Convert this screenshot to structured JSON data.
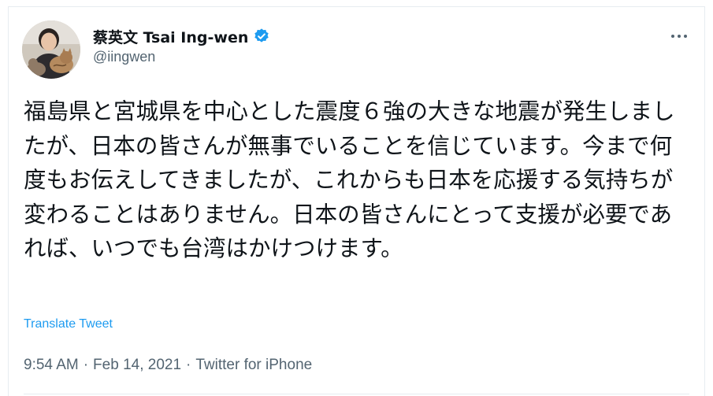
{
  "tweet": {
    "author": {
      "display_name": "蔡英文 Tsai Ing-wen",
      "handle": "@iingwen",
      "verified": true,
      "avatar_icon": "profile-photo-with-cat"
    },
    "more_icon": "ellipsis-horizontal-icon",
    "text": "福島県と宮城県を中心とした震度６強の大きな地震が発生しましたが、日本の皆さんが無事でいることを信じています。今まで何度もお伝えしてきましたが、これからも日本を応援する気持ちが変わることはありません。日本の皆さんにとって支援が必要であれば、いつでも台湾はかけつけます。",
    "translate_label": "Translate Tweet",
    "time": "9:54 AM",
    "date": "Feb 14, 2021",
    "source": "Twitter for iPhone",
    "separator": "·"
  },
  "colors": {
    "text": "#0f1419",
    "secondary": "#536471",
    "link": "#1d9bf0",
    "verified": "#1d9bf0",
    "border": "#e6ecf0"
  }
}
